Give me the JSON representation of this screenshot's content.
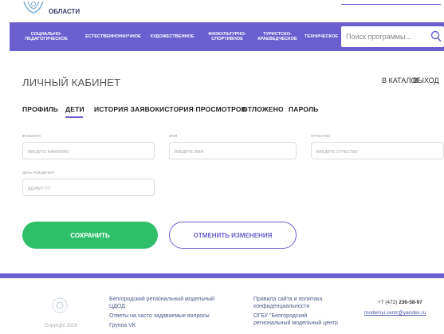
{
  "header": {
    "region_text": "ОБЛАСТИ"
  },
  "nav": {
    "items": [
      {
        "label": "СОЦИАЛЬНО-\nПЕДАГОГИЧЕСКОЕ"
      },
      {
        "label": "ЕСТЕСТВЕННОНАУЧНОЕ"
      },
      {
        "label": "ХУДОЖЕСТВЕННОЕ"
      },
      {
        "label": "ФИЗКУЛЬТУРНО-\nСПОРТИВНОЕ"
      },
      {
        "label": "ТУРИСТСКО-\nКРАЕВЕДЧЕСКОЕ"
      },
      {
        "label": "ТЕХНИЧЕСКОЕ"
      }
    ],
    "search_placeholder": "Поиск программы...",
    "search_value": ""
  },
  "cabinet": {
    "title": "ЛИЧНЫЙ КАБИНЕТ",
    "catalog_label": "В КАТАЛОГ",
    "logout_label": "ВЫХОД"
  },
  "tabs": [
    {
      "label": "ПРОФИЛЬ"
    },
    {
      "label": "ДЕТИ"
    },
    {
      "label": "ИСТОРИЯ ЗАЯВОК"
    },
    {
      "label": "ИСТОРИЯ ПРОСМОТРОВ"
    },
    {
      "label": "ОТЛОЖЕНО"
    },
    {
      "label": "ПАРОЛЬ"
    }
  ],
  "active_tab": "ДЕТИ",
  "form": {
    "surname": {
      "label": "ФАМИЛИЯ",
      "placeholder": "ВВЕДИТЕ ФАМИЛИЮ",
      "value": ""
    },
    "name": {
      "label": "ИМЯ",
      "placeholder": "ВВЕДИТЕ ИМЯ",
      "value": ""
    },
    "patronymic": {
      "label": "ОТЧЕСТВО",
      "placeholder": "ВВЕДИТЕ ОТЧЕСТВО",
      "value": ""
    },
    "birthday": {
      "label": "ДЕНЬ РОЖДЕНИЯ",
      "placeholder": "ДД.ММ.ГГГГ",
      "value": ""
    }
  },
  "actions": {
    "save_label": "СОХРАНИТЬ",
    "cancel_label": "ОТМЕНИТЬ ИЗМЕНЕНИЯ"
  },
  "footer": {
    "copyright": "Copyright 2019",
    "col1": [
      "Белгородский региональный модельный",
      "ЦДОД",
      "Ответы на часто задаваемые вопросы",
      "Группа VK"
    ],
    "col2": [
      "Правила сайта и политика",
      "конфиденциальности",
      "ОГБУ \"Белгородский",
      "региональный модельный центр"
    ],
    "phone_prefix": "+7 (472) ",
    "phone_number": "236-58-97",
    "email": "modelnyi.centr@yandex.ru"
  },
  "colors": {
    "accent": "#6b5fd0",
    "save_green": "#2fbf6b"
  }
}
